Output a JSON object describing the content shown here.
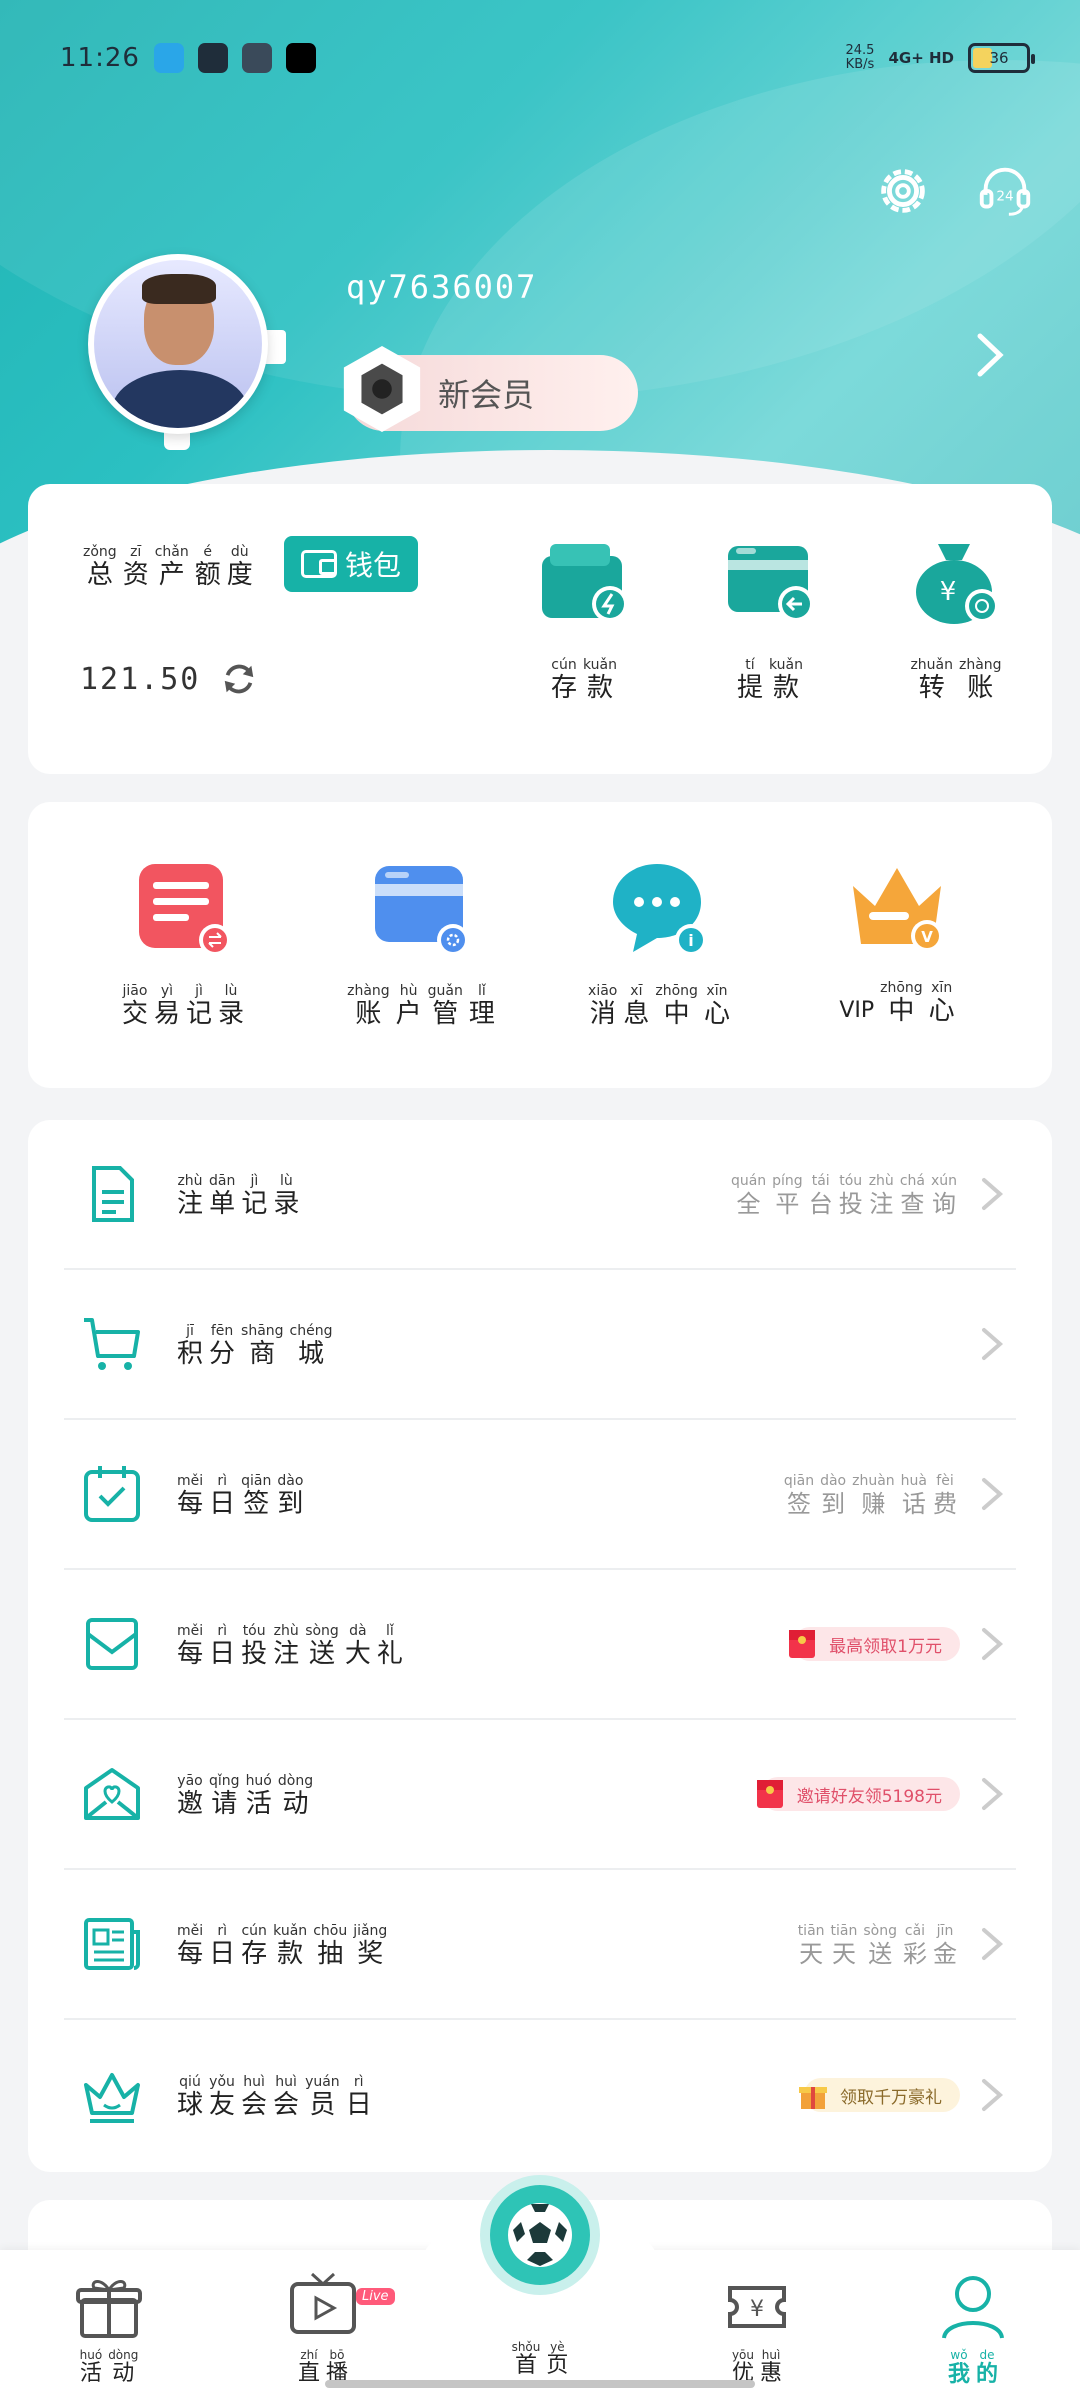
{
  "status_bar": {
    "time": "11:26",
    "speed_value": "24.5",
    "speed_unit": "KB/s",
    "network": "4G+ HD",
    "battery": "36",
    "battery_level": 0.36
  },
  "profile": {
    "username": "qy7636007",
    "member_level": "新会员"
  },
  "assets": {
    "title": [
      {
        "p": "zǒng",
        "h": "总"
      },
      {
        "p": "zī",
        "h": "资"
      },
      {
        "p": "chǎn",
        "h": "产"
      },
      {
        "p": "é",
        "h": "额"
      },
      {
        "p": "dù",
        "h": "度"
      }
    ],
    "wallet_button": "钱包",
    "amount": "121.50",
    "actions": [
      {
        "name": "deposit",
        "chars": [
          {
            "p": "cún",
            "h": "存"
          },
          {
            "p": "kuǎn",
            "h": "款"
          }
        ]
      },
      {
        "name": "withdraw",
        "chars": [
          {
            "p": "tí",
            "h": "提"
          },
          {
            "p": "kuǎn",
            "h": "款"
          }
        ]
      },
      {
        "name": "transfer",
        "chars": [
          {
            "p": "zhuǎn",
            "h": "转"
          },
          {
            "p": "zhàng",
            "h": "账"
          }
        ]
      }
    ]
  },
  "shortcuts": [
    {
      "name": "transactions",
      "chars": [
        {
          "p": "jiāo",
          "h": "交"
        },
        {
          "p": "yì",
          "h": "易"
        },
        {
          "p": "jì",
          "h": "记"
        },
        {
          "p": "lù",
          "h": "录"
        }
      ]
    },
    {
      "name": "accounts",
      "chars": [
        {
          "p": "zhàng",
          "h": "账"
        },
        {
          "p": "hù",
          "h": "户"
        },
        {
          "p": "guǎn",
          "h": "管"
        },
        {
          "p": "lǐ",
          "h": "理"
        }
      ]
    },
    {
      "name": "messages",
      "chars": [
        {
          "p": "xiāo",
          "h": "消"
        },
        {
          "p": "xī",
          "h": "息"
        },
        {
          "p": "zhōng",
          "h": "中"
        },
        {
          "p": "xīn",
          "h": "心"
        }
      ]
    },
    {
      "name": "vip",
      "prefix": "VIP",
      "chars": [
        {
          "p": "zhōng",
          "h": "中"
        },
        {
          "p": "xīn",
          "h": "心"
        }
      ]
    }
  ],
  "menu": [
    {
      "name": "bet-records",
      "chars": [
        {
          "p": "zhù",
          "h": "注"
        },
        {
          "p": "dān",
          "h": "单"
        },
        {
          "p": "jì",
          "h": "记"
        },
        {
          "p": "lù",
          "h": "录"
        }
      ],
      "hint": [
        {
          "p": "quán",
          "h": "全"
        },
        {
          "p": "píng",
          "h": "平"
        },
        {
          "p": "tái",
          "h": "台"
        },
        {
          "p": "tóu",
          "h": "投"
        },
        {
          "p": "zhù",
          "h": "注"
        },
        {
          "p": "chá",
          "h": "查"
        },
        {
          "p": "xún",
          "h": "询"
        }
      ]
    },
    {
      "name": "points-mall",
      "chars": [
        {
          "p": "jī",
          "h": "积"
        },
        {
          "p": "fēn",
          "h": "分"
        },
        {
          "p": "shāng",
          "h": "商"
        },
        {
          "p": "chéng",
          "h": "城"
        }
      ]
    },
    {
      "name": "daily-checkin",
      "chars": [
        {
          "p": "měi",
          "h": "每"
        },
        {
          "p": "rì",
          "h": "日"
        },
        {
          "p": "qiān",
          "h": "签"
        },
        {
          "p": "dào",
          "h": "到"
        }
      ],
      "hint": [
        {
          "p": "qiān",
          "h": "签"
        },
        {
          "p": "dào",
          "h": "到"
        },
        {
          "p": "zhuàn",
          "h": "赚"
        },
        {
          "p": "huà",
          "h": "话"
        },
        {
          "p": "fèi",
          "h": "费"
        }
      ]
    },
    {
      "name": "daily-bet-gift",
      "chars": [
        {
          "p": "měi",
          "h": "每"
        },
        {
          "p": "rì",
          "h": "日"
        },
        {
          "p": "tóu",
          "h": "投"
        },
        {
          "p": "zhù",
          "h": "注"
        },
        {
          "p": "sòng",
          "h": "送"
        },
        {
          "p": "dà",
          "h": "大"
        },
        {
          "p": "lǐ",
          "h": "礼"
        }
      ],
      "promo": "最高领取1万元",
      "promo_style": "red"
    },
    {
      "name": "invite",
      "chars": [
        {
          "p": "yāo",
          "h": "邀"
        },
        {
          "p": "qǐng",
          "h": "请"
        },
        {
          "p": "huó",
          "h": "活"
        },
        {
          "p": "dòng",
          "h": "动"
        }
      ],
      "promo": "邀请好友领5198元",
      "promo_style": "red"
    },
    {
      "name": "daily-deposit-draw",
      "chars": [
        {
          "p": "měi",
          "h": "每"
        },
        {
          "p": "rì",
          "h": "日"
        },
        {
          "p": "cún",
          "h": "存"
        },
        {
          "p": "kuǎn",
          "h": "款"
        },
        {
          "p": "chōu",
          "h": "抽"
        },
        {
          "p": "jiǎng",
          "h": "奖"
        }
      ],
      "hint": [
        {
          "p": "tiān",
          "h": "天"
        },
        {
          "p": "tiān",
          "h": "天"
        },
        {
          "p": "sòng",
          "h": "送"
        },
        {
          "p": "cǎi",
          "h": "彩"
        },
        {
          "p": "jīn",
          "h": "金"
        }
      ]
    },
    {
      "name": "fan-member-day",
      "chars": [
        {
          "p": "qiú",
          "h": "球"
        },
        {
          "p": "yǒu",
          "h": "友"
        },
        {
          "p": "huì",
          "h": "会"
        },
        {
          "p": "huì",
          "h": "会"
        },
        {
          "p": "yuán",
          "h": "员"
        },
        {
          "p": "rì",
          "h": "日"
        }
      ],
      "promo": "领取千万豪礼",
      "promo_style": "gold"
    }
  ],
  "tabbar": [
    {
      "name": "activities",
      "chars": [
        {
          "p": "huó",
          "h": "活"
        },
        {
          "p": "dòng",
          "h": "动"
        }
      ]
    },
    {
      "name": "live",
      "chars": [
        {
          "p": "zhí",
          "h": "直"
        },
        {
          "p": "bō",
          "h": "播"
        }
      ],
      "tag": "Live"
    },
    {
      "name": "home",
      "chars": [
        {
          "p": "shǒu",
          "h": "首"
        },
        {
          "p": "yè",
          "h": "页"
        }
      ]
    },
    {
      "name": "offers",
      "chars": [
        {
          "p": "yōu",
          "h": "优"
        },
        {
          "p": "huì",
          "h": "惠"
        }
      ]
    },
    {
      "name": "mine",
      "chars": [
        {
          "p": "wǒ",
          "h": "我"
        },
        {
          "p": "de",
          "h": "的"
        }
      ],
      "active": true
    }
  ],
  "colors": {
    "accent": "#17b2a7",
    "header": "#2bc0c2",
    "promo_red": "#e0506a"
  }
}
